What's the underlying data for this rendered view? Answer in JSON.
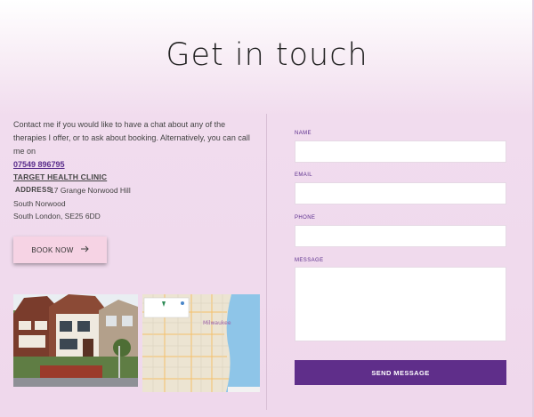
{
  "page": {
    "title": "Get in touch"
  },
  "contact": {
    "intro": "Contact me if you would like to have a chat about any of the therapies I offer, or to ask about booking. Alternatively, you can call me on",
    "phone": "07549 896795",
    "clinic_name": "TARGET HEALTH CLINIC",
    "address_label": "ADDRESS",
    "address_lines": [
      "17 Grange Norwood Hill",
      "South Norwood",
      "South London, SE25 6DD"
    ],
    "book_label": "BOOK NOW"
  },
  "map": {
    "city_label": "Milwaukee"
  },
  "form": {
    "name_label": "NAME",
    "email_label": "EMAIL",
    "phone_label": "PHONE",
    "message_label": "MESSAGE",
    "submit_label": "SEND MESSAGE"
  },
  "colors": {
    "accent": "#5f2e8a",
    "button_pink": "#f6d3e4",
    "background": "#efd8ec"
  },
  "icons": {
    "book_arrow": "arrow-right-icon"
  }
}
